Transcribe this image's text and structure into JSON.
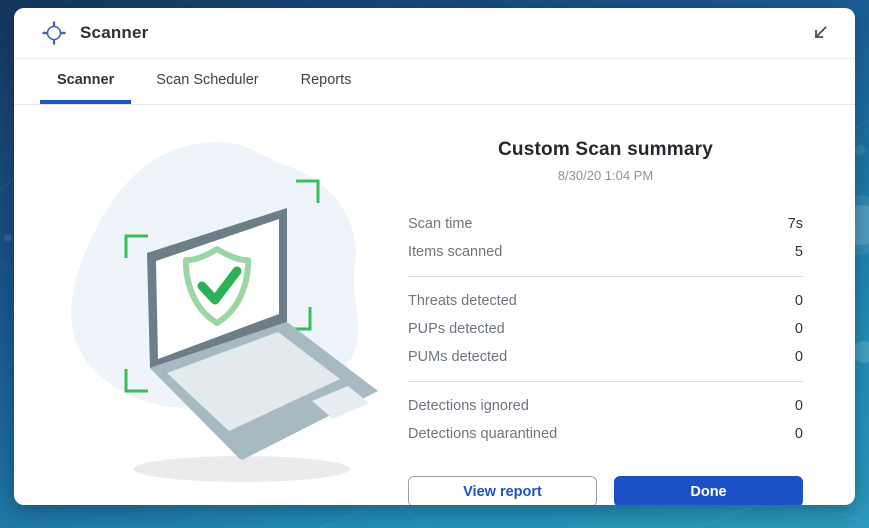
{
  "window": {
    "title": "Scanner",
    "icons": {
      "title_icon": "crosshair-target",
      "collapse_icon": "arrow-collapse-bottom-left"
    }
  },
  "tabs": [
    {
      "label": "Scanner",
      "active": true
    },
    {
      "label": "Scan Scheduler",
      "active": false
    },
    {
      "label": "Reports",
      "active": false
    }
  ],
  "summary": {
    "title": "Custom Scan summary",
    "timestamp": "8/30/20 1:04 PM",
    "groups": [
      [
        {
          "label": "Scan time",
          "value": "7s"
        },
        {
          "label": "Items scanned",
          "value": "5"
        }
      ],
      [
        {
          "label": "Threats detected",
          "value": "0"
        },
        {
          "label": "PUPs detected",
          "value": "0"
        },
        {
          "label": "PUMs detected",
          "value": "0"
        }
      ],
      [
        {
          "label": "Detections ignored",
          "value": "0"
        },
        {
          "label": "Detections quarantined",
          "value": "0"
        }
      ]
    ],
    "buttons": {
      "view_report": "View report",
      "done": "Done"
    }
  },
  "illustration": {
    "name": "laptop-with-shield-checkmark-scan",
    "elements": [
      "background-blob",
      "scan-viewfinder-brackets",
      "laptop",
      "shield-checkmark",
      "shadow"
    ]
  },
  "colors": {
    "accent_blue": "#1d4fc6",
    "tab_underline_blue": "#1d52c9",
    "success_green": "#2db155",
    "shield_outline_green": "#9bd7a5",
    "bracket_green": "#3dbb61",
    "background_navy": "#16375f",
    "background_teal": "#2b9abc",
    "label_gray": "#6e767f",
    "value_dark": "#2f343a"
  }
}
